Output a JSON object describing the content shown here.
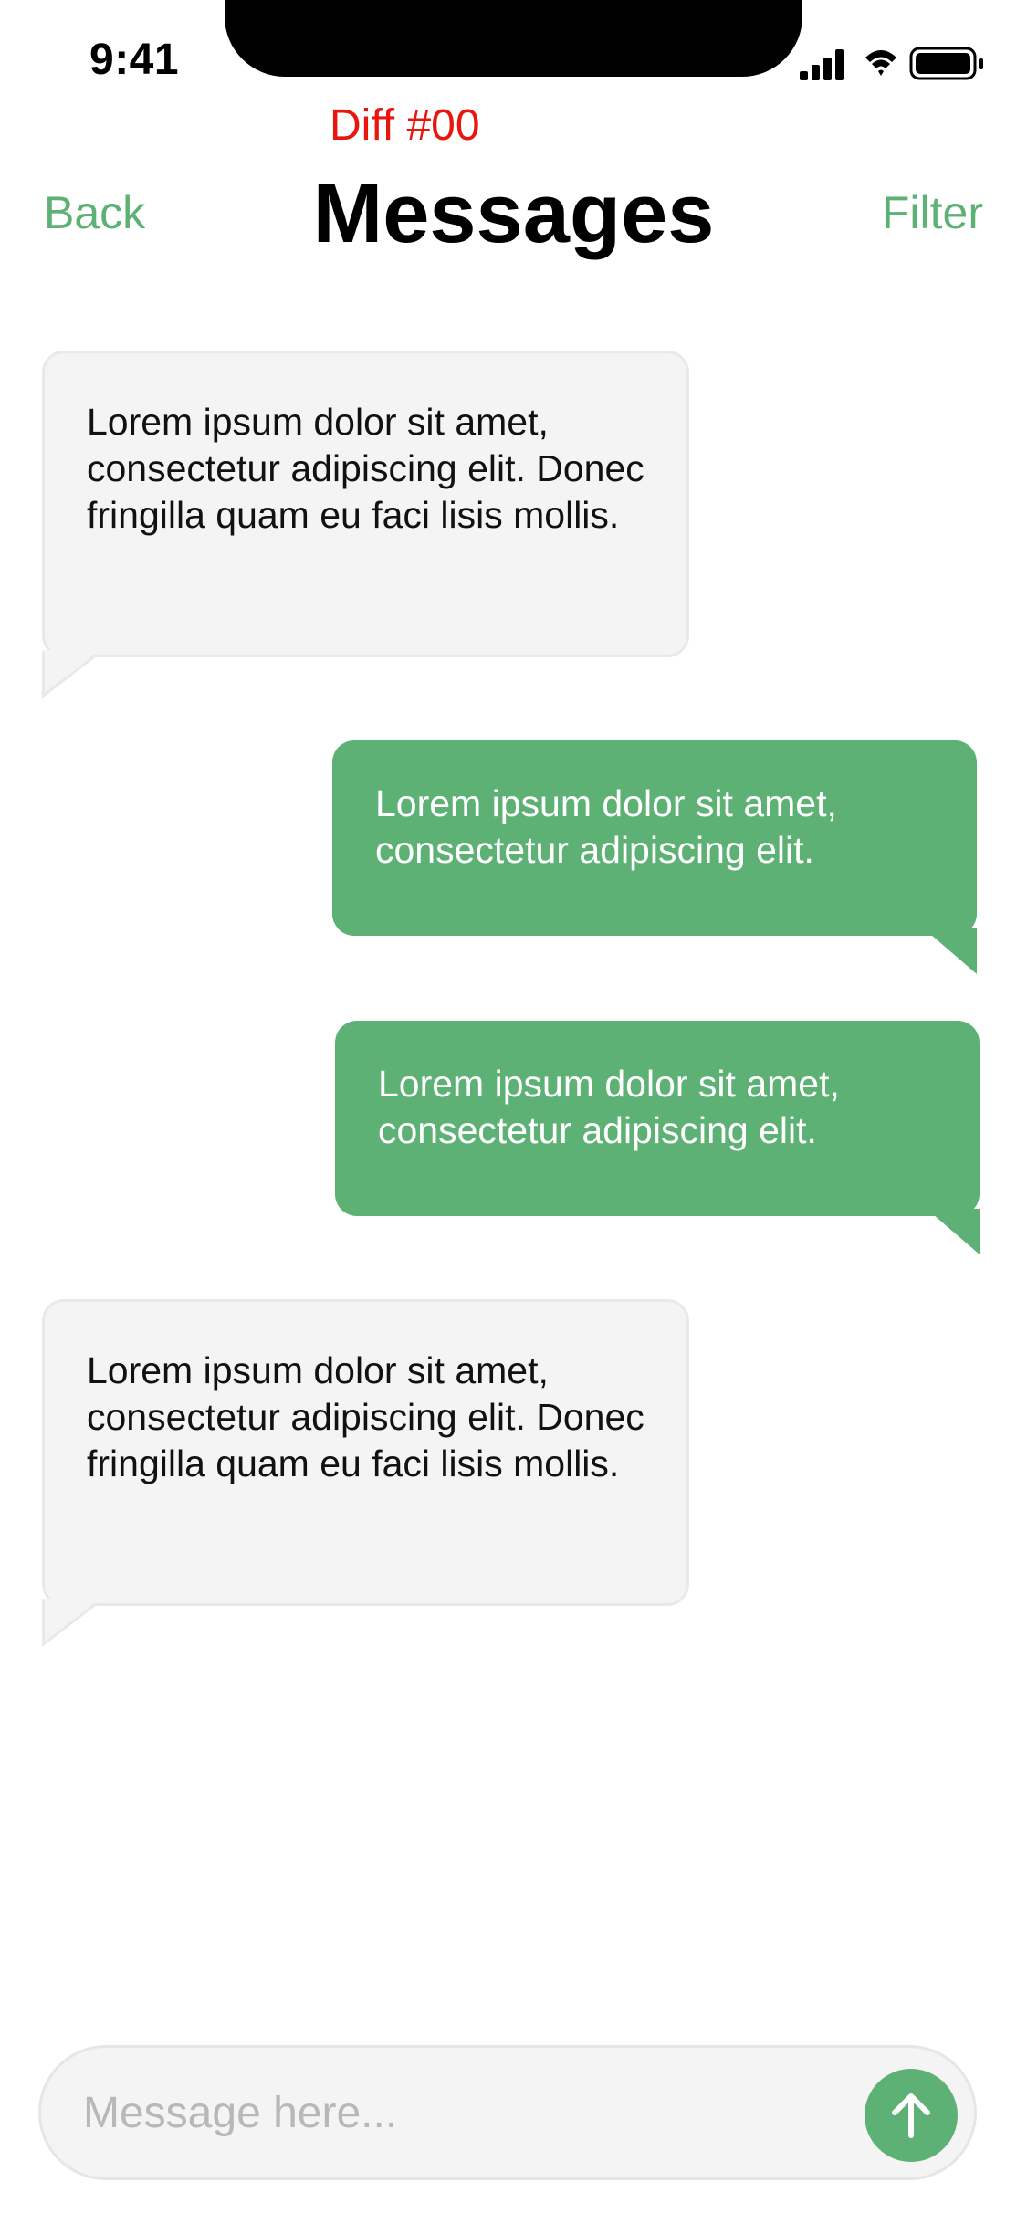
{
  "status_bar": {
    "time": "9:41",
    "icons": [
      "cellular-signal-icon",
      "wifi-icon",
      "battery-icon"
    ]
  },
  "diff_label": "Diff #00",
  "header": {
    "back_label": "Back",
    "title": "Messages",
    "filter_label": "Filter"
  },
  "messages": [
    {
      "direction": "incoming",
      "text": "Lorem ipsum dolor sit amet, consectetur adipiscing elit. Donec fringilla quam eu faci lisis mollis."
    },
    {
      "direction": "outgoing",
      "text": "Lorem ipsum dolor sit amet, consectetur adipiscing elit."
    },
    {
      "direction": "outgoing",
      "text": "Lorem ipsum dolor sit amet, consectetur adipiscing elit."
    },
    {
      "direction": "incoming",
      "text": "Lorem ipsum dolor sit amet, consectetur adipiscing elit. Donec fringilla quam eu faci lisis mollis."
    }
  ],
  "composer": {
    "placeholder": "Message here...",
    "value": "",
    "send_icon": "arrow-up-icon"
  },
  "colors": {
    "accent": "#5db174",
    "incoming_bubble": "#f4f4f4",
    "diff_label": "#e8160e"
  }
}
